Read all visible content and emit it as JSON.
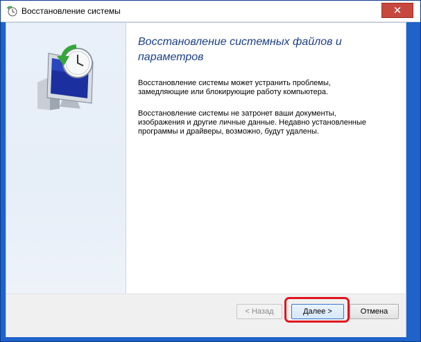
{
  "window": {
    "title": "Восстановление системы",
    "close_label": "✕"
  },
  "main": {
    "heading": "Восстановление системных файлов и параметров",
    "paragraph1": "Восстановление системы может устранить проблемы,\nзамедляющие или блокирующие работу компьютера.",
    "paragraph2": "Восстановление системы не затронет ваши документы,\nизображения и другие личные данные. Недавно установленные\nпрограммы и драйверы, возможно, будут удалены."
  },
  "buttons": {
    "back": "< Назад",
    "next": "Далее >",
    "cancel": "Отмена"
  },
  "colors": {
    "heading": "#1b3f86",
    "highlight": "#e0141e",
    "window_frame": "#1f62c9"
  },
  "icons": {
    "app": "system-restore-icon",
    "hero": "monitor-clock-restore-icon"
  }
}
